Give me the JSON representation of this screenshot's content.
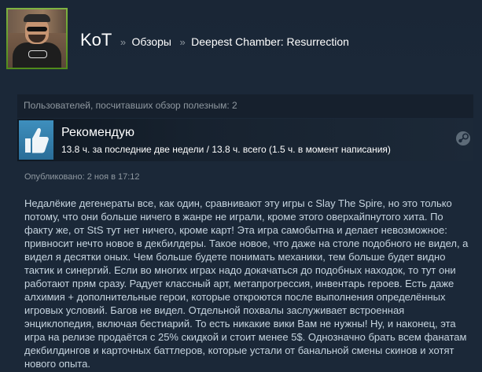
{
  "header": {
    "username": "KoT",
    "separator": "»",
    "breadcrumb_reviews": "Обзоры",
    "breadcrumb_game": "Deepest Chamber: Resurrection"
  },
  "helpful": {
    "text": "Пользователей, посчитавших обзор полезным: 2"
  },
  "verdict": {
    "title": "Рекомендую",
    "hours": "13.8 ч. за последние две недели / 13.8 ч. всего (1.5 ч. в момент написания)",
    "thumb_icon": "thumbs-up-icon",
    "platform_icon": "steam-icon"
  },
  "posted": {
    "text": "Опубликовано: 2 ноя в 17:12"
  },
  "review": {
    "text": "Недалёкие дегенераты все, как один, сравнивают эту игры с Slay The Spire, но это только потому, что они больше ничего в жанре не играли, кроме этого оверхайпнутого хита. По факту же, от StS тут нет ничего, кроме карт! Эта игра самобытна и делает невозможное: привносит нечто новое в декбилдеры. Такое новое, что даже на столе подобного не видел, а видел я десятки оных. Чем больше будете понимать механики, тем больше будет видно тактик и синергий. Если во многих играх надо докачаться до подобных находок, то тут они работают прям сразу. Радует классный арт, метапрогрессия, инвентарь героев. Есть даже алхимия + дополнительные герои, которые откроются после выполнения определённых игровых условий. Багов не видел. Отдельной похвалы заслуживает встроенная энциклопедия, включая бестиарий. То есть никакие вики Вам не нужны! Ну, и наконец, эта игра на релизе продаётся с 25% скидкой и стоит менее 5$. Однозначно брать всем фанатам декбилдингов и карточных баттлеров, которые устали от банальной смены скинов и хотят нового опыта."
  },
  "colors": {
    "background": "#1b2838",
    "thumb_blue": "#3e8fbd",
    "avatar_frame": "#7fb342",
    "muted_text": "#8f98a0",
    "body_text": "#c6d4df"
  }
}
